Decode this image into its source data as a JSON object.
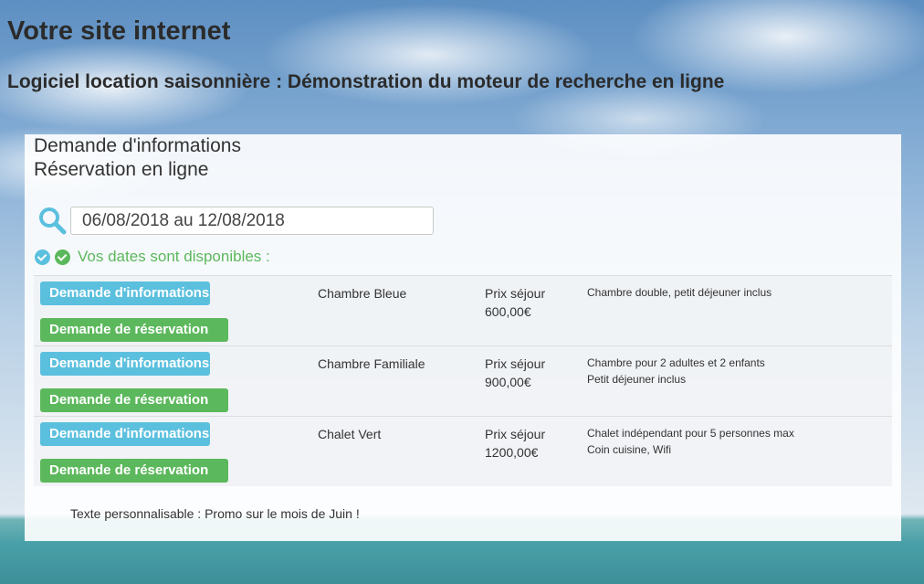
{
  "site": {
    "title": "Votre site internet",
    "subtitle": "Logiciel location saisonnière : Démonstration du moteur de recherche en ligne"
  },
  "panel": {
    "link_info": "Demande d'informations",
    "link_reservation": "Réservation en ligne",
    "search": {
      "value": "06/08/2018 au 12/08/2018",
      "icon": "search-icon"
    },
    "availability": "Vos dates sont disponibles :",
    "rooms": [
      {
        "info_button": "Demande d'informations",
        "reservation_button": "Demande de réservation",
        "name": "Chambre Bleue",
        "price_label": "Prix séjour",
        "price": "600,00€",
        "desc_line1": "Chambre double, petit déjeuner inclus",
        "desc_line2": ""
      },
      {
        "info_button": "Demande d'informations",
        "reservation_button": "Demande de réservation",
        "name": "Chambre Familiale",
        "price_label": "Prix séjour",
        "price": "900,00€",
        "desc_line1": "Chambre pour 2 adultes et 2 enfants",
        "desc_line2": "Petit déjeuner inclus"
      },
      {
        "info_button": "Demande d'informations",
        "reservation_button": "Demande de réservation",
        "name": "Chalet Vert",
        "price_label": "Prix séjour",
        "price": "1200,00€",
        "desc_line1": "Chalet indépendant pour 5 personnes max",
        "desc_line2": "Coin cuisine, Wifi"
      }
    ],
    "promo": "Texte personnalisable : Promo sur le mois de Juin !"
  },
  "colors": {
    "info": "#5bc0de",
    "success": "#5cb85c"
  }
}
